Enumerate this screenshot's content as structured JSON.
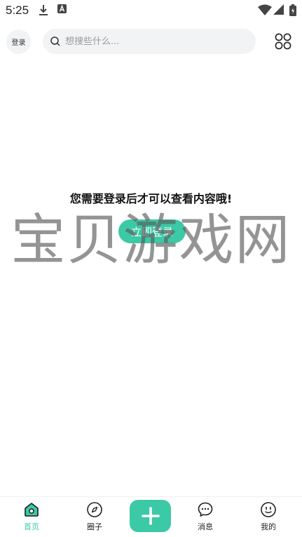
{
  "status_bar": {
    "time": "5:25",
    "icons": [
      "download-icon",
      "font-a-icon",
      "wifi-icon",
      "signal-icon",
      "battery-icon"
    ]
  },
  "header": {
    "login_label": "登录",
    "search_placeholder": "想搜些什么...",
    "menu_icon": "grid-menu-icon"
  },
  "main": {
    "prompt": "您需要登录后才可以查看内容哦!",
    "login_button": "立即登录"
  },
  "watermark": "宝贝游戏网",
  "bottom_nav": {
    "items": [
      {
        "label": "首页",
        "icon": "home-icon",
        "active": true
      },
      {
        "label": "圈子",
        "icon": "compass-icon",
        "active": false
      },
      {
        "label": "",
        "icon": "plus-icon",
        "active": false
      },
      {
        "label": "消息",
        "icon": "chat-icon",
        "active": false
      },
      {
        "label": "我的",
        "icon": "profile-face-icon",
        "active": false
      }
    ]
  },
  "colors": {
    "accent": "#3cc9a5",
    "search_bg": "#f2f3f5",
    "text": "#111111"
  }
}
